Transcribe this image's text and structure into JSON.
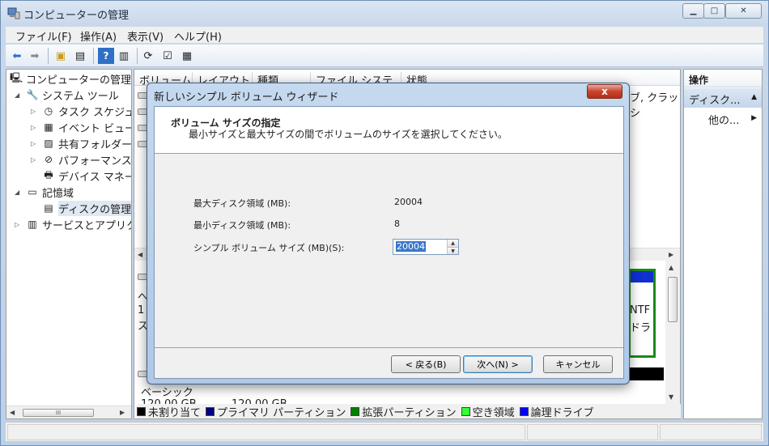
{
  "window": {
    "title": "コンピューターの管理"
  },
  "menu": [
    "ファイル(F)",
    "操作(A)",
    "表示(V)",
    "ヘルプ(H)"
  ],
  "tree": {
    "root": "コンピューターの管理",
    "items": [
      {
        "label": "システム ツール",
        "level": 1,
        "expander": "◢",
        "icon": "tools-icon"
      },
      {
        "label": "タスク スケジュ",
        "level": 2,
        "expander": "▷",
        "icon": "clock-icon"
      },
      {
        "label": "イベント ビュー",
        "level": 2,
        "expander": "▷",
        "icon": "event-icon"
      },
      {
        "label": "共有フォルダー",
        "level": 2,
        "expander": "▷",
        "icon": "share-icon"
      },
      {
        "label": "パフォーマンス",
        "level": 2,
        "expander": "▷",
        "icon": "perf-icon"
      },
      {
        "label": "デバイス マネー",
        "level": 2,
        "expander": "",
        "icon": "device-icon"
      },
      {
        "label": "記憶域",
        "level": 1,
        "expander": "◢",
        "icon": "storage-icon"
      },
      {
        "label": "ディスクの管理",
        "level": 2,
        "expander": "",
        "icon": "disk-icon",
        "selected": true
      },
      {
        "label": "サービスとアプリク",
        "level": 1,
        "expander": "▷",
        "icon": "services-icon"
      }
    ],
    "scroll_thumb": "III"
  },
  "columns": [
    "ボリューム",
    "レイアウト",
    "種類",
    "ファイル システム",
    "状態"
  ],
  "clipped": {
    "status_row": "ブ, クラッシ",
    "ntfs": "NTF",
    "dora": "ドラ",
    "basic": "ベーシック",
    "size": "120.00 GB",
    "size2": "120.00 GB",
    "letter_he": "へ",
    "num_1": "1",
    "kanji_su": "ス"
  },
  "legend": [
    {
      "label": "未割り当て",
      "color": "#000000"
    },
    {
      "label": "プライマリ パーティション",
      "color": "#000080"
    },
    {
      "label": "拡張パーティション",
      "color": "#008000"
    },
    {
      "label": "空き領域",
      "color": "#33ff33"
    },
    {
      "label": "論理ドライブ",
      "color": "#0000ff"
    }
  ],
  "actions": {
    "header": "操作",
    "section": "ディスク...",
    "item": "他の..."
  },
  "dialog": {
    "title": "新しいシンプル ボリューム ウィザード",
    "header_title": "ボリューム サイズの指定",
    "header_desc": "最小サイズと最大サイズの間でボリュームのサイズを選択してください。",
    "fields": {
      "max_label": "最大ディスク領域 (MB):",
      "max_value": "20004",
      "min_label": "最小ディスク領域 (MB):",
      "min_value": "8",
      "size_label": "シンプル ボリューム サイズ (MB)(S):",
      "size_value": "20004"
    },
    "buttons": {
      "back": "< 戻る(B)",
      "next": "次へ(N) >",
      "cancel": "キャンセル"
    },
    "close_glyph": "x"
  }
}
